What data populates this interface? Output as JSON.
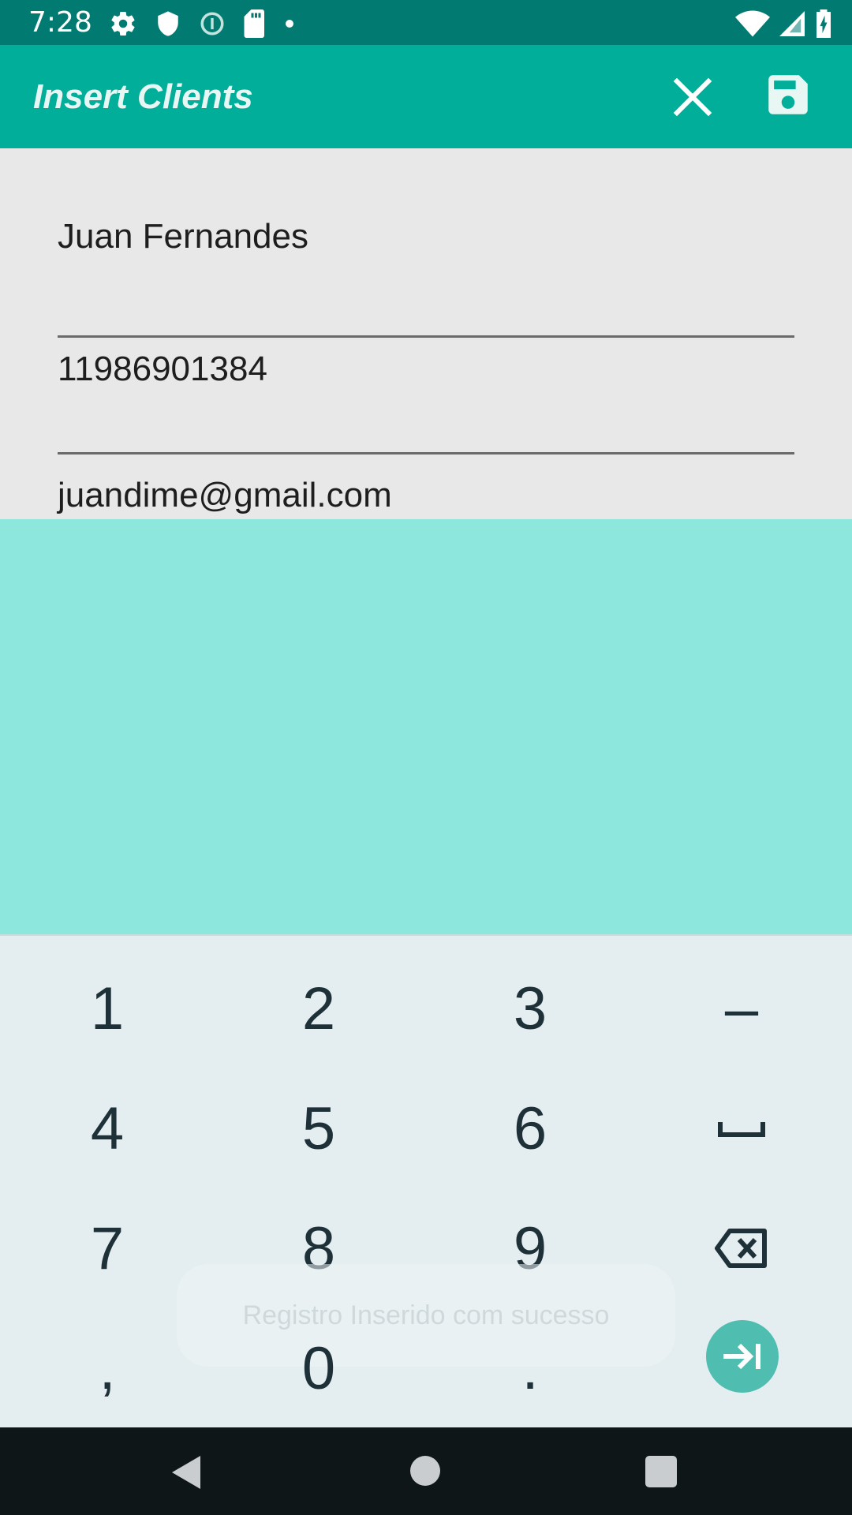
{
  "status_bar": {
    "time": "7:28",
    "icons_left": [
      "settings-icon",
      "shield-icon",
      "info-icon",
      "sd-card-icon",
      "dot-icon"
    ],
    "icons_right": [
      "wifi-icon",
      "signal-icon",
      "battery-charging-icon"
    ]
  },
  "app_bar": {
    "title": "Insert Clients",
    "actions": [
      "close-icon",
      "save-icon"
    ]
  },
  "form": {
    "name_value": "Juan Fernandes",
    "phone_value": "11986901384",
    "email_value": "juandime@gmail.com"
  },
  "keyboard": {
    "row1": [
      "1",
      "2",
      "3",
      "–"
    ],
    "row2": [
      "4",
      "5",
      "6",
      "space-icon"
    ],
    "row3": [
      "7",
      "8",
      "9",
      "backspace-icon"
    ],
    "row4": [
      ",",
      "0",
      ".",
      "next-icon"
    ]
  },
  "toast": {
    "message": "Registro Inserido com sucesso"
  },
  "colors": {
    "status_bar": "#017a71",
    "app_bar": "#00ae99",
    "overlay": "#8ee7dd",
    "keyboard": "#e4eef0",
    "enter_button": "#4fbdaf"
  }
}
